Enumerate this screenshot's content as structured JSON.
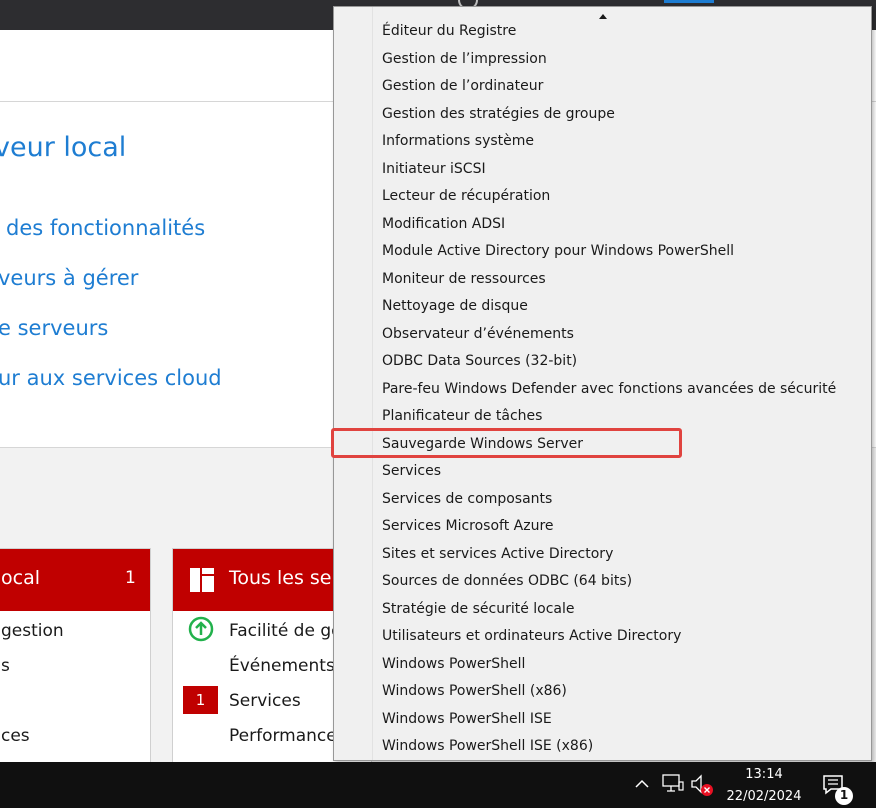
{
  "quick_start": {
    "title": "veur local",
    "links": [
      "des fonctionnalités",
      "veurs à gérer",
      "e serveurs",
      "ur aux services cloud"
    ]
  },
  "tiles": [
    {
      "title": "ocal",
      "count": "1",
      "rows": [
        "gestion",
        "s",
        "",
        "ces"
      ]
    },
    {
      "title": "Tous les serv",
      "rows": [
        "Facilité de ges",
        "Événements",
        "Services",
        "Performances"
      ],
      "services_badge": "1"
    }
  ],
  "tools_menu": {
    "items": [
      "Éditeur du Registre",
      "Gestion de l’impression",
      "Gestion de l’ordinateur",
      "Gestion des stratégies de groupe",
      "Informations système",
      "Initiateur iSCSI",
      "Lecteur de récupération",
      "Modification ADSI",
      "Module Active Directory pour Windows PowerShell",
      "Moniteur de ressources",
      "Nettoyage de disque",
      "Observateur d’événements",
      "ODBC Data Sources (32-bit)",
      "Pare-feu Windows Defender avec fonctions avancées de sécurité",
      "Planificateur de tâches",
      "Sauvegarde Windows Server",
      "Services",
      "Services de composants",
      "Services Microsoft Azure",
      "Sites et services Active Directory",
      "Sources de données ODBC (64 bits)",
      "Stratégie de sécurité locale",
      "Utilisateurs et ordinateurs Active Directory",
      "Windows PowerShell",
      "Windows PowerShell (x86)",
      "Windows PowerShell ISE",
      "Windows PowerShell ISE (x86)"
    ],
    "highlighted": "Sauvegarde Windows Server"
  },
  "taskbar": {
    "time": "13:14",
    "date": "22/02/2024",
    "notification_count": "1",
    "icons": [
      "chevron-up-icon",
      "network-icon",
      "speaker-muted-icon",
      "notification-icon"
    ]
  },
  "colors": {
    "accent": "#1e7dd2",
    "tile_red": "#c00000",
    "highlight_box": "#e0433f",
    "menu_bg": "#f0f0f0",
    "taskbar": "#101010"
  }
}
